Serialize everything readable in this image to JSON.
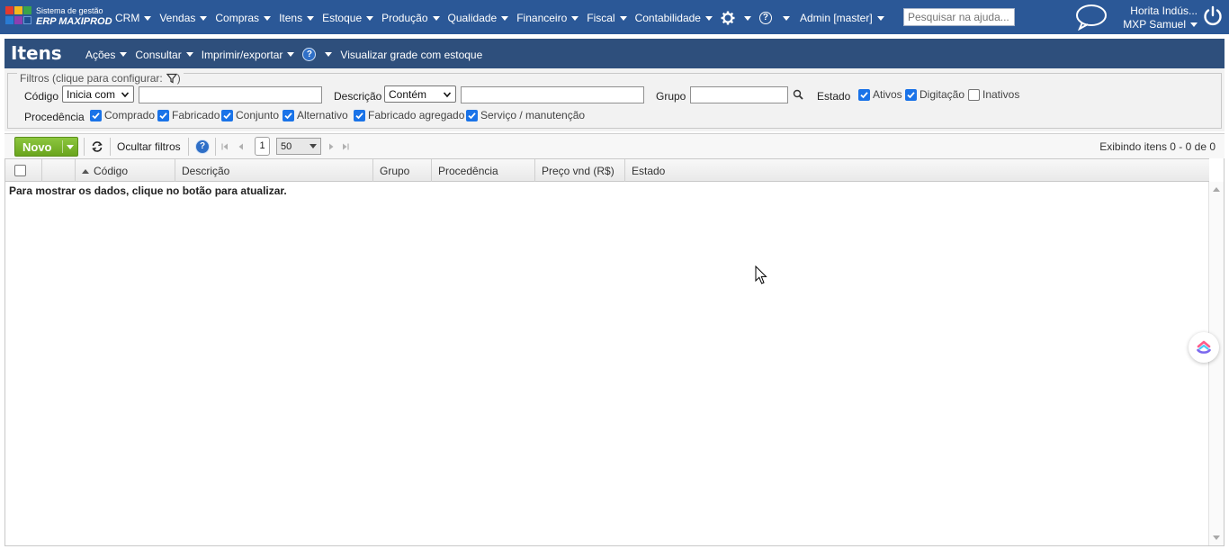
{
  "app": {
    "brand_line1": "Sistema de gestão",
    "brand_line2": "ERP MAXIPROD",
    "nav_bg": "#2b5897"
  },
  "nav": {
    "items": [
      "CRM",
      "Vendas",
      "Compras",
      "Itens",
      "Estoque",
      "Produção",
      "Qualidade",
      "Financeiro",
      "Fiscal",
      "Contabilidade"
    ],
    "settings_icon": "gear-icon",
    "help_icon": "question-icon",
    "admin_label": "Admin [master]",
    "search_placeholder": "Pesquisar na ajuda...",
    "company": "Horita Indús...",
    "user": "MXP Samuel"
  },
  "titlebar": {
    "title": "Itens",
    "actions": "Ações",
    "consult": "Consultar",
    "print": "Imprimir/exportar",
    "help_glyph": "?",
    "grid_stock": "Visualizar grade com estoque"
  },
  "filters": {
    "legend": "Filtros (clique para configurar:",
    "legend_close": ")",
    "codigo_label": "Código",
    "codigo_mode": "Inicia com",
    "codigo_value": "",
    "descricao_label": "Descrição",
    "descricao_mode": "Contém",
    "descricao_value": "",
    "grupo_label": "Grupo",
    "grupo_value": "",
    "estado_label": "Estado",
    "estado": [
      {
        "label": "Ativos",
        "checked": true
      },
      {
        "label": "Digitação",
        "checked": true
      },
      {
        "label": "Inativos",
        "checked": false
      }
    ],
    "procedencia_label": "Procedência",
    "procedencia": [
      {
        "label": "Comprado",
        "checked": true
      },
      {
        "label": "Fabricado",
        "checked": true
      },
      {
        "label": "Conjunto",
        "checked": true
      },
      {
        "label": "Alternativo",
        "checked": true
      },
      {
        "label": "Fabricado agregado",
        "checked": true
      },
      {
        "label": "Serviço / manutenção",
        "checked": true
      }
    ]
  },
  "toolbar": {
    "novo": "Novo",
    "hide_filters": "Ocultar filtros",
    "help_glyph": "?",
    "page": "1",
    "page_size": "50",
    "records": "Exibindo itens 0 - 0 de 0"
  },
  "grid": {
    "columns": [
      "Código",
      "Descrição",
      "Grupo",
      "Procedência",
      "Preço vnd (R$)",
      "Estado"
    ],
    "empty_message": "Para mostrar os dados, clique no botão para atualizar."
  }
}
